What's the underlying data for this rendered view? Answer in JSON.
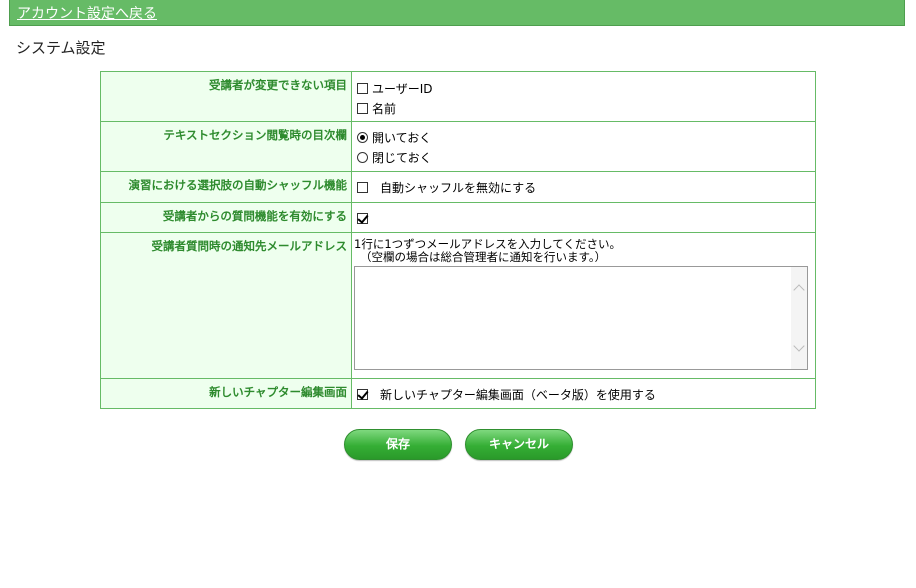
{
  "header": {
    "back_link": "アカウント設定へ戻る"
  },
  "page_title": "システム設定",
  "settings": {
    "fixed_items": {
      "label": "受講者が変更できない項目",
      "options": [
        {
          "label": "ユーザーID",
          "checked": false
        },
        {
          "label": "名前",
          "checked": false
        }
      ]
    },
    "toc": {
      "label": "テキストセクション閲覧時の目次欄",
      "options": [
        {
          "label": "開いておく",
          "selected": true
        },
        {
          "label": "閉じておく",
          "selected": false
        }
      ]
    },
    "shuffle": {
      "label": "演習における選択肢の自動シャッフル機能",
      "option": {
        "label": "自動シャッフルを無効にする",
        "checked": false
      }
    },
    "question": {
      "label": "受講者からの質問機能を有効にする",
      "checked": true
    },
    "notify": {
      "label": "受講者質問時の通知先メールアドレス",
      "help_line1": "1行に1つずつメールアドレスを入力してください。",
      "help_line2": "（空欄の場合は総合管理者に通知を行います。）",
      "value": ""
    },
    "chapter_editor": {
      "label": "新しいチャプター編集画面",
      "option": {
        "label": "新しいチャプター編集画面（ベータ版）を使用する",
        "checked": true
      }
    }
  },
  "buttons": {
    "save": "保存",
    "cancel": "キャンセル"
  },
  "colors": {
    "header_bg": "#66bb66",
    "label_text": "#2e8b2e",
    "label_bg": "#eeffee",
    "border": "#66bb66"
  }
}
